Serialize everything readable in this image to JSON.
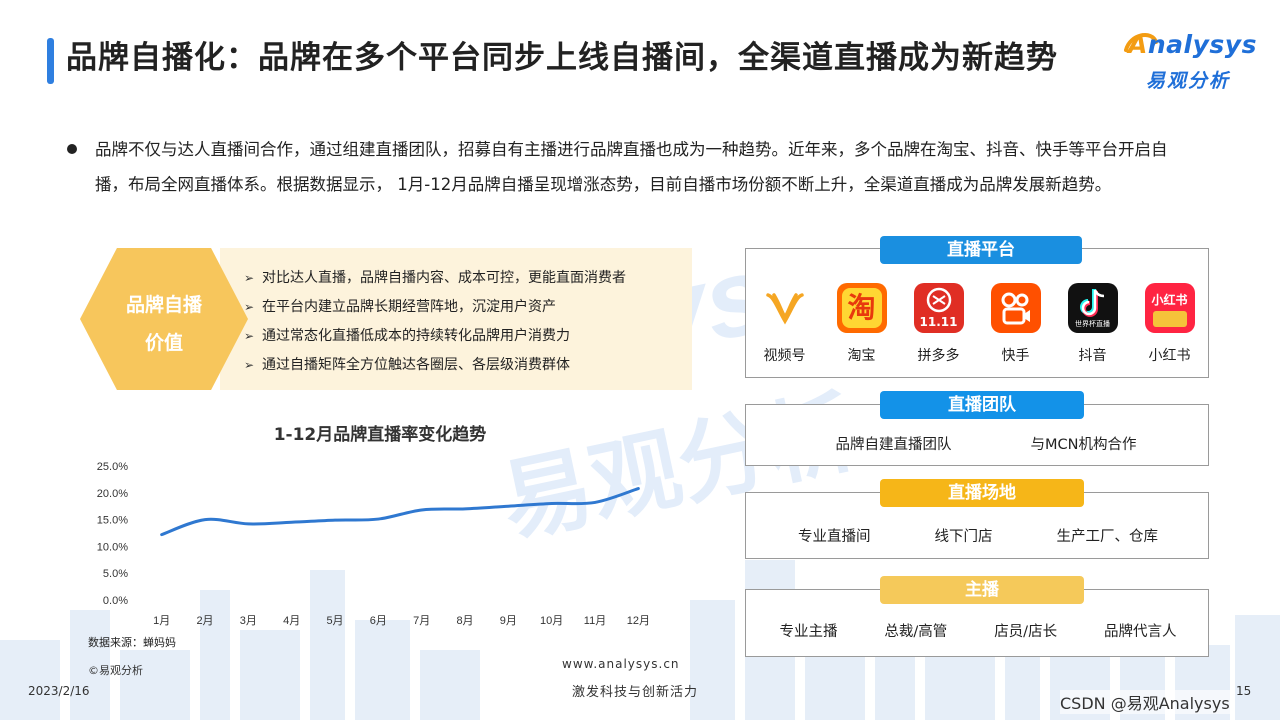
{
  "title": "品牌自播化：品牌在多个平台同步上线自播间，全渠道直播成为新趋势",
  "logo": {
    "brand_en_rest": "nalysys",
    "brand_en_first": "A",
    "brand_cn": "易观分析"
  },
  "bullet": "品牌不仅与达人直播间合作，通过组建直播团队，招募自有主播进行品牌直播也成为一种趋势。近年来，多个品牌在淘宝、抖音、快手等平台开启自播，布局全网直播体系。根据数据显示， 1月-12月品牌自播呈现增涨态势，目前自播市场份额不断上升，全渠道直播成为品牌发展新趋势。",
  "value_section": {
    "hex_label_line1": "品牌自播",
    "hex_label_line2": "价值",
    "items": [
      "对比达人直播，品牌自播内容、成本可控，更能直面消费者",
      "在平台内建立品牌长期经营阵地，沉淀用户资产",
      "通过常态化直播低成本的持续转化品牌用户消费力",
      "通过自播矩阵全方位触达各圈层、各层级消费群体"
    ]
  },
  "chart_data": {
    "type": "line",
    "title": "1-12月品牌直播率变化趋势",
    "categories": [
      "1月",
      "2月",
      "3月",
      "4月",
      "5月",
      "6月",
      "7月",
      "8月",
      "9月",
      "10月",
      "11月",
      "12月"
    ],
    "series": [
      {
        "values": [
          12.2,
          15.0,
          14.2,
          14.5,
          14.9,
          15.1,
          16.8,
          17.0,
          17.5,
          18.0,
          18.2,
          20.8
        ]
      }
    ],
    "y_ticks": [
      "0.0%",
      "5.0%",
      "10.0%",
      "15.0%",
      "20.0%",
      "25.0%"
    ],
    "ylim": [
      0,
      25
    ],
    "line_color": "#2f78d0",
    "grid": false
  },
  "source": "数据来源：蝉妈妈",
  "copyright": "©易观分析",
  "website": "www.analysys.cn",
  "slogan": "激发科技与创新活力",
  "date": "2023/2/16",
  "page_number": "15",
  "csdn_watermark": "CSDN @易观Analysys",
  "panels": {
    "platforms": {
      "header": "直播平台",
      "items": [
        {
          "label": "视频号",
          "icon": "wechat-channels-icon"
        },
        {
          "label": "淘宝",
          "icon": "taobao-icon",
          "glyph": "淘"
        },
        {
          "label": "拼多多",
          "icon": "pinduoduo-icon",
          "glyph": "11.11"
        },
        {
          "label": "快手",
          "icon": "kuaishou-icon"
        },
        {
          "label": "抖音",
          "icon": "douyin-icon",
          "glyph": "世界杯直播"
        },
        {
          "label": "小红书",
          "icon": "xiaohongshu-icon",
          "glyph": "小红书"
        }
      ]
    },
    "team": {
      "header": "直播团队",
      "items": [
        "品牌自建直播团队",
        "与MCN机构合作"
      ]
    },
    "venue": {
      "header": "直播场地",
      "items": [
        "专业直播间",
        "线下门店",
        "生产工厂、仓库"
      ]
    },
    "host": {
      "header": "主播",
      "items": [
        "专业主播",
        "总裁/高管",
        "店员/店长",
        "品牌代言人"
      ]
    }
  }
}
